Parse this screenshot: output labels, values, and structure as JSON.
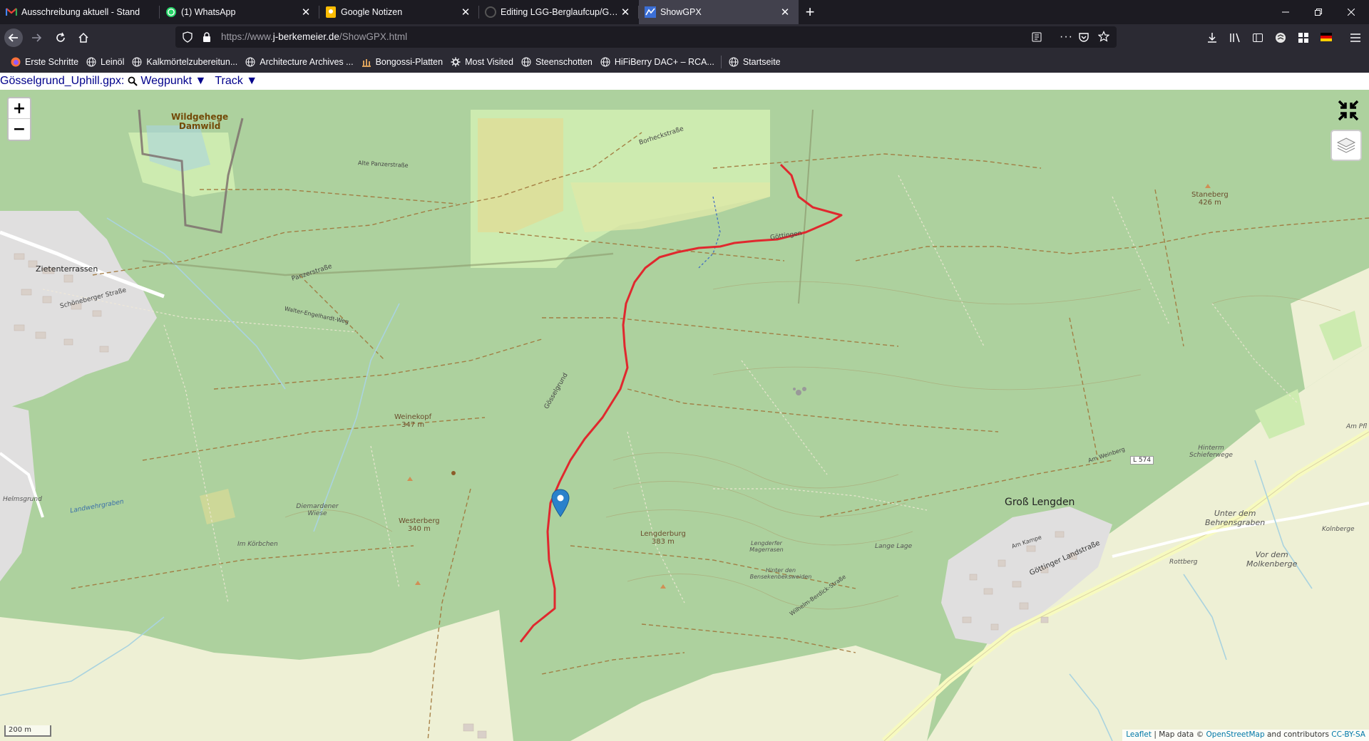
{
  "tabs": [
    {
      "title": "Ausschreibung aktuell - Stand",
      "icon": "gmail-icon"
    },
    {
      "title": "(1) WhatsApp",
      "icon": "whatsapp-icon"
    },
    {
      "title": "Google Notizen",
      "icon": "google-keep-icon"
    },
    {
      "title": "Editing LGG-Berglaufcup/Göss",
      "icon": "github-icon"
    },
    {
      "title": "ShowGPX",
      "icon": "showgpx-icon",
      "active": true
    }
  ],
  "url": {
    "prefix": "https://www.",
    "host": "j-berkemeier.de",
    "path": "/ShowGPX.html"
  },
  "bookmarks": [
    {
      "label": "Erste Schritte",
      "icon": "firefox-icon"
    },
    {
      "label": "Leinöl",
      "icon": "globe-icon"
    },
    {
      "label": "Kalkmörtelzubereitun...",
      "icon": "globe-icon"
    },
    {
      "label": "Architecture Archives ...",
      "icon": "globe-icon"
    },
    {
      "label": "Bongossi-Platten",
      "icon": "bongossi-icon"
    },
    {
      "label": "Most Visited",
      "icon": "gear-icon"
    },
    {
      "label": "Steenschotten",
      "icon": "globe-icon"
    },
    {
      "label": "HiFiBerry DAC+ – RCA...",
      "icon": "globe-icon"
    },
    {
      "label": "Startseite",
      "icon": "globe-icon"
    }
  ],
  "infobar": {
    "filename": "Gösselgrund_Uphill.gpx:",
    "waypoint": "Wegpunkt ▼",
    "track": "Track ▼"
  },
  "map": {
    "zoom_in": "+",
    "zoom_out": "−",
    "scale": "200 m",
    "attribution": {
      "leaflet": "Leaflet",
      "sep": " | Map data © ",
      "osm": "OpenStreetMap",
      "contrib": " and contributors ",
      "license": "CC-BY-SA"
    },
    "track_color": "#e0282e",
    "marker_color": "#2a81cb",
    "labels": [
      {
        "text": "Wildgehege",
        "name": "label-wildgehege"
      },
      {
        "text": "Damwild",
        "name": "label-damwild"
      },
      {
        "text": "Zietenterrassen",
        "name": "label-zietenterrassen"
      },
      {
        "text": "Staneberg",
        "name": "label-staneberg"
      },
      {
        "text": "426 m",
        "name": "label-staneberg-ele"
      },
      {
        "text": "Weinekopf",
        "name": "label-weinekopf"
      },
      {
        "text": "347 m",
        "name": "label-weinekopf-ele"
      },
      {
        "text": "Westerberg",
        "name": "label-westerberg"
      },
      {
        "text": "340 m",
        "name": "label-westerberg-ele"
      },
      {
        "text": "Lengderburg",
        "name": "label-lengderburg"
      },
      {
        "text": "383 m",
        "name": "label-lengderburg-ele"
      },
      {
        "text": "Groß Lengden",
        "name": "label-gross-lengden"
      },
      {
        "text": "L 574",
        "name": "label-l574"
      },
      {
        "text": "Unter dem",
        "name": "label-unter-dem"
      },
      {
        "text": "Behrensgraben",
        "name": "label-behrensgraben"
      },
      {
        "text": "Vor dem",
        "name": "label-vor-dem"
      },
      {
        "text": "Molkenberge",
        "name": "label-molkenberge"
      },
      {
        "text": "Göttinger Landstraße",
        "name": "label-goettinger-landstrasse"
      },
      {
        "text": "Hinterm",
        "name": "label-hinterm"
      },
      {
        "text": "Schieferwege",
        "name": "label-schieferwege"
      },
      {
        "text": "Borheckstraße",
        "name": "label-borheckstrasse"
      },
      {
        "text": "Gösselgrund",
        "name": "label-goesselgrund"
      },
      {
        "text": "Göttingen",
        "name": "label-goettingen"
      },
      {
        "text": "Panzerstraße",
        "name": "label-panzerstrasse"
      },
      {
        "text": "Schöneberger Straße",
        "name": "label-schoeneberger"
      },
      {
        "text": "Im Körbchen",
        "name": "label-im-koerbchen"
      },
      {
        "text": "Diemardener Wiese",
        "name": "label-diemardener"
      },
      {
        "text": "Lange Lage",
        "name": "label-lange-lage"
      },
      {
        "text": "Rottberg",
        "name": "label-rottberg"
      },
      {
        "text": "Helmsgrund",
        "name": "label-helmsgrund"
      },
      {
        "text": "Am Kampe",
        "name": "label-am-kampe"
      },
      {
        "text": "Am Weinberg",
        "name": "label-am-weinberg"
      },
      {
        "text": "Landwehrgraben",
        "name": "label-landwehrgraben"
      },
      {
        "text": "Lengderfer Magerrasen",
        "name": "label-magerrasen"
      },
      {
        "text": "Hinter den Bensekenbeksweiden",
        "name": "label-bensekenbek"
      },
      {
        "text": "Wilhelm-Berdick-Straße",
        "name": "label-wilhelm-berdick"
      },
      {
        "text": "Kolnberge",
        "name": "label-kolnberge"
      },
      {
        "text": "Am Pfl",
        "name": "label-am-pfl"
      },
      {
        "text": "Walter-Engelhardt-Weg",
        "name": "label-walter-engelhardt"
      },
      {
        "text": "Alte Panzerstraße",
        "name": "label-alte-panzerstrasse"
      }
    ]
  }
}
